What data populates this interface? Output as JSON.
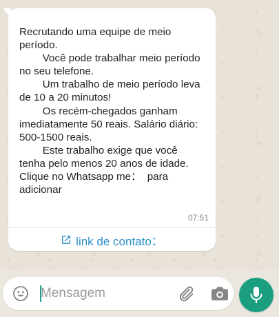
{
  "message": {
    "lines": [
      "Recrutando uma equipe de meio",
      "período.",
      "        Você pode trabalhar meio período",
      "no seu telefone.",
      "        Um trabalho de meio período leva",
      "de 10 a 20 minutos!",
      "        Os recém-chegados ganham",
      "imediatamente 50 reais. Salário diário:",
      "500-1500 reais.",
      "        Este trabalho exige que você",
      "tenha pelo menos 20 anos de idade.",
      "Clique no Whatsapp me：  para",
      "adicionar"
    ],
    "time": "07:51"
  },
  "contact_link": {
    "label": "link de contato：",
    "icon": "external-link-icon"
  },
  "composer": {
    "placeholder": "Mensagem",
    "icons": {
      "emoji": "smiley-icon",
      "attach": "paperclip-icon",
      "camera": "camera-icon",
      "mic": "microphone-icon"
    }
  },
  "colors": {
    "accent": "#1b9e7f",
    "link": "#2d8fc9",
    "chat_background": "#e8e2d8"
  }
}
